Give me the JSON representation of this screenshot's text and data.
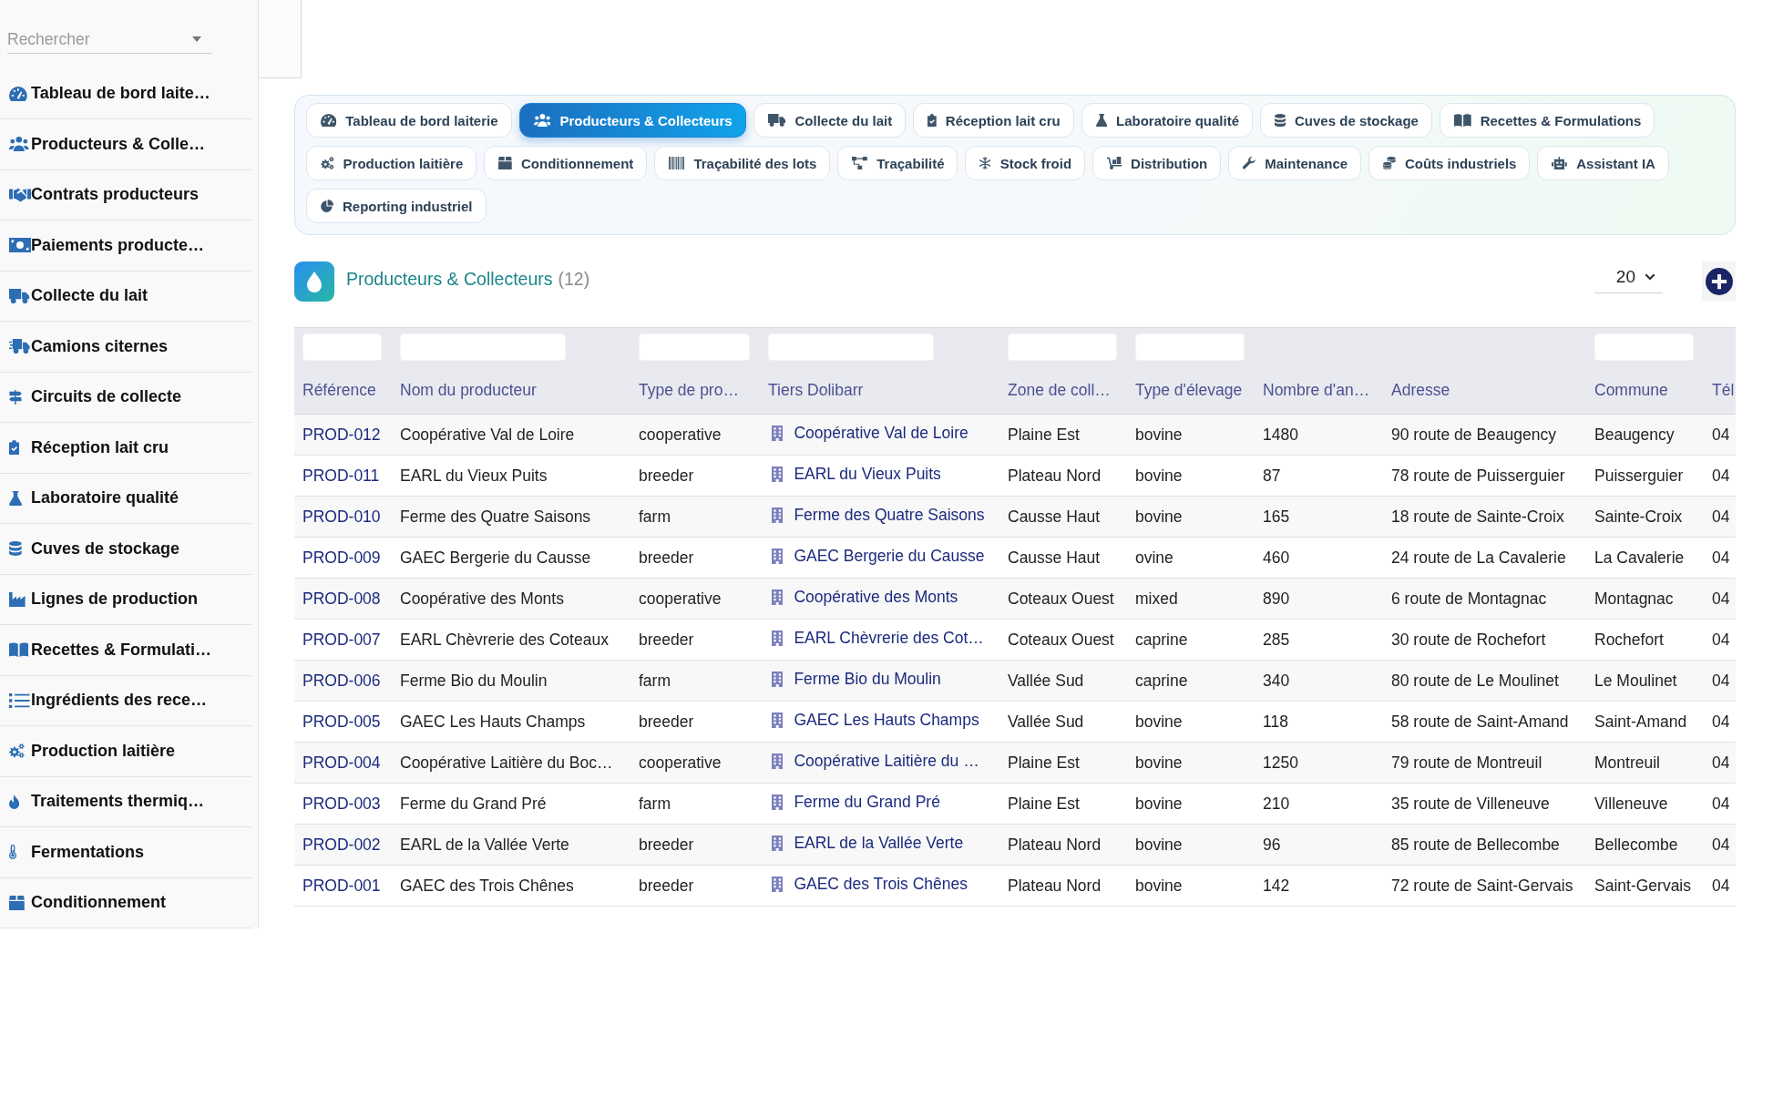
{
  "sidebar": {
    "search": {
      "placeholder": "Rechercher"
    },
    "items": [
      "Tableau de bord laite…",
      "Producteurs & Colle…",
      "Contrats producteurs",
      "Paiements producte…",
      "Collecte du lait",
      "Camions citernes",
      "Circuits de collecte",
      "Réception lait cru",
      "Laboratoire qualité",
      "Cuves de stockage",
      "Lignes de production",
      "Recettes & Formulati…",
      "Ingrédients des rece…",
      "Production laitière",
      "Traitements thermiq…",
      "Fermentations",
      "Conditionnement"
    ]
  },
  "tabs": [
    {
      "label": "Tableau de bord laiterie",
      "selected": false
    },
    {
      "label": "Producteurs & Collecteurs",
      "selected": true
    },
    {
      "label": "Collecte du lait",
      "selected": false
    },
    {
      "label": "Réception lait cru",
      "selected": false
    },
    {
      "label": "Laboratoire qualité",
      "selected": false
    },
    {
      "label": "Cuves de stockage",
      "selected": false
    },
    {
      "label": "Recettes & Formulations",
      "selected": false
    },
    {
      "label": "Production laitière",
      "selected": false
    },
    {
      "label": "Conditionnement",
      "selected": false
    },
    {
      "label": "Traçabilité des lots",
      "selected": false
    },
    {
      "label": "Traçabilité",
      "selected": false
    },
    {
      "label": "Stock froid",
      "selected": false
    },
    {
      "label": "Distribution",
      "selected": false
    },
    {
      "label": "Maintenance",
      "selected": false
    },
    {
      "label": "Coûts industriels",
      "selected": false
    },
    {
      "label": "Assistant IA",
      "selected": false
    },
    {
      "label": "Reporting industriel",
      "selected": false
    }
  ],
  "page_header": {
    "title": "Producteurs & Collecteurs",
    "count": "(12)",
    "page_size": "20"
  },
  "table": {
    "columns": [
      {
        "label": "Référence",
        "kind": "link",
        "filter": true
      },
      {
        "label": "Nom du producteur",
        "kind": "text",
        "filter": true
      },
      {
        "label": "Type de pro…",
        "kind": "text",
        "filter": true
      },
      {
        "label": "Tiers Dolibarr",
        "kind": "tiers",
        "filter": true
      },
      {
        "label": "Zone de coll…",
        "kind": "text",
        "filter": true
      },
      {
        "label": "Type d'élevage",
        "kind": "text",
        "filter": true
      },
      {
        "label": "Nombre d'an…",
        "kind": "text",
        "filter": false
      },
      {
        "label": "Adresse",
        "kind": "text",
        "filter": false
      },
      {
        "label": "Commune",
        "kind": "text",
        "filter": true
      },
      {
        "label": "Tél",
        "kind": "text",
        "filter": false
      }
    ],
    "rows": [
      [
        "PROD-012",
        "Coopérative Val de Loire",
        "cooperative",
        "Coopérative Val de Loire",
        "Plaine Est",
        "bovine",
        "1480",
        "90 route de Beaugency",
        "Beaugency",
        "04"
      ],
      [
        "PROD-011",
        "EARL du Vieux Puits",
        "breeder",
        "EARL du Vieux Puits",
        "Plateau Nord",
        "bovine",
        "87",
        "78 route de Puisserguier",
        "Puisserguier",
        "04"
      ],
      [
        "PROD-010",
        "Ferme des Quatre Saisons",
        "farm",
        "Ferme des Quatre Saisons",
        "Causse Haut",
        "bovine",
        "165",
        "18 route de Sainte-Croix",
        "Sainte-Croix",
        "04"
      ],
      [
        "PROD-009",
        "GAEC Bergerie du Causse",
        "breeder",
        "GAEC Bergerie du Causse",
        "Causse Haut",
        "ovine",
        "460",
        "24 route de La Cavalerie",
        "La Cavalerie",
        "04"
      ],
      [
        "PROD-008",
        "Coopérative des Monts",
        "cooperative",
        "Coopérative des Monts",
        "Coteaux Ouest",
        "mixed",
        "890",
        "6 route de Montagnac",
        "Montagnac",
        "04"
      ],
      [
        "PROD-007",
        "EARL Chèvrerie des Coteaux",
        "breeder",
        "EARL Chèvrerie des Cot…",
        "Coteaux Ouest",
        "caprine",
        "285",
        "30 route de Rochefort",
        "Rochefort",
        "04"
      ],
      [
        "PROD-006",
        "Ferme Bio du Moulin",
        "farm",
        "Ferme Bio du Moulin",
        "Vallée Sud",
        "caprine",
        "340",
        "80 route de Le Moulinet",
        "Le Moulinet",
        "04"
      ],
      [
        "PROD-005",
        "GAEC Les Hauts Champs",
        "breeder",
        "GAEC Les Hauts Champs",
        "Vallée Sud",
        "bovine",
        "118",
        "58 route de Saint-Amand",
        "Saint-Amand",
        "04"
      ],
      [
        "PROD-004",
        "Coopérative Laitière du Boc…",
        "cooperative",
        "Coopérative Laitière du …",
        "Plaine Est",
        "bovine",
        "1250",
        "79 route de Montreuil",
        "Montreuil",
        "04"
      ],
      [
        "PROD-003",
        "Ferme du Grand Pré",
        "farm",
        "Ferme du Grand Pré",
        "Plaine Est",
        "bovine",
        "210",
        "35 route de Villeneuve",
        "Villeneuve",
        "04"
      ],
      [
        "PROD-002",
        "EARL de la Vallée Verte",
        "breeder",
        "EARL de la Vallée Verte",
        "Plateau Nord",
        "bovine",
        "96",
        "85 route de Bellecombe",
        "Bellecombe",
        "04"
      ],
      [
        "PROD-001",
        "GAEC des Trois Chênes",
        "breeder",
        "GAEC des Trois Chênes",
        "Plateau Nord",
        "bovine",
        "142",
        "72 route de Saint-Gervais",
        "Saint-Gervais",
        "04"
      ]
    ]
  }
}
